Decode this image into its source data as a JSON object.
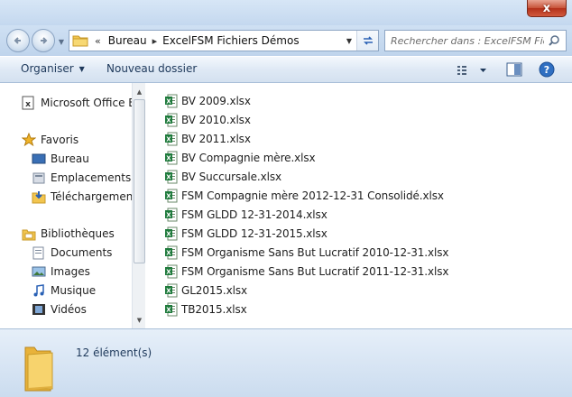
{
  "window": {
    "close_glyph": "x"
  },
  "address": {
    "history_glyph": "«",
    "crumbs": [
      "Bureau",
      "ExcelFSM Fichiers Démos"
    ],
    "separator": "▸"
  },
  "search": {
    "placeholder": "Rechercher dans : ExcelFSM Fic..."
  },
  "toolbar": {
    "organize_label": "Organiser",
    "new_folder_label": "Nouveau dossier"
  },
  "nav": {
    "items": [
      {
        "label": "Microsoft Office Ex",
        "icon": "excel-app-icon"
      },
      {
        "label": "Favoris",
        "icon": "star-icon"
      },
      {
        "label": "Bureau",
        "icon": "desktop-icon"
      },
      {
        "label": "Emplacements ré",
        "icon": "recent-places-icon"
      },
      {
        "label": "Téléchargements",
        "icon": "downloads-icon"
      },
      {
        "label": "Bibliothèques",
        "icon": "libraries-icon"
      },
      {
        "label": "Documents",
        "icon": "documents-icon"
      },
      {
        "label": "Images",
        "icon": "pictures-icon"
      },
      {
        "label": "Musique",
        "icon": "music-icon"
      },
      {
        "label": "Vidéos",
        "icon": "videos-icon"
      }
    ]
  },
  "files": [
    "BV 2009.xlsx",
    "BV 2010.xlsx",
    "BV 2011.xlsx",
    "BV Compagnie mère.xlsx",
    "BV Succursale.xlsx",
    "FSM  Compagnie mère 2012-12-31 Consolidé.xlsx",
    "FSM GLDD 12-31-2014.xlsx",
    "FSM GLDD 12-31-2015.xlsx",
    "FSM Organisme Sans But Lucratif 2010-12-31.xlsx",
    "FSM Organisme Sans But Lucratif 2011-12-31.xlsx",
    "GL2015.xlsx",
    "TB2015.xlsx"
  ],
  "details": {
    "item_count": "12 élément(s)"
  },
  "colors": {
    "excel_green": "#1d7a3b",
    "close_red": "#c75238",
    "folder_yellow": "#f2c54f"
  }
}
